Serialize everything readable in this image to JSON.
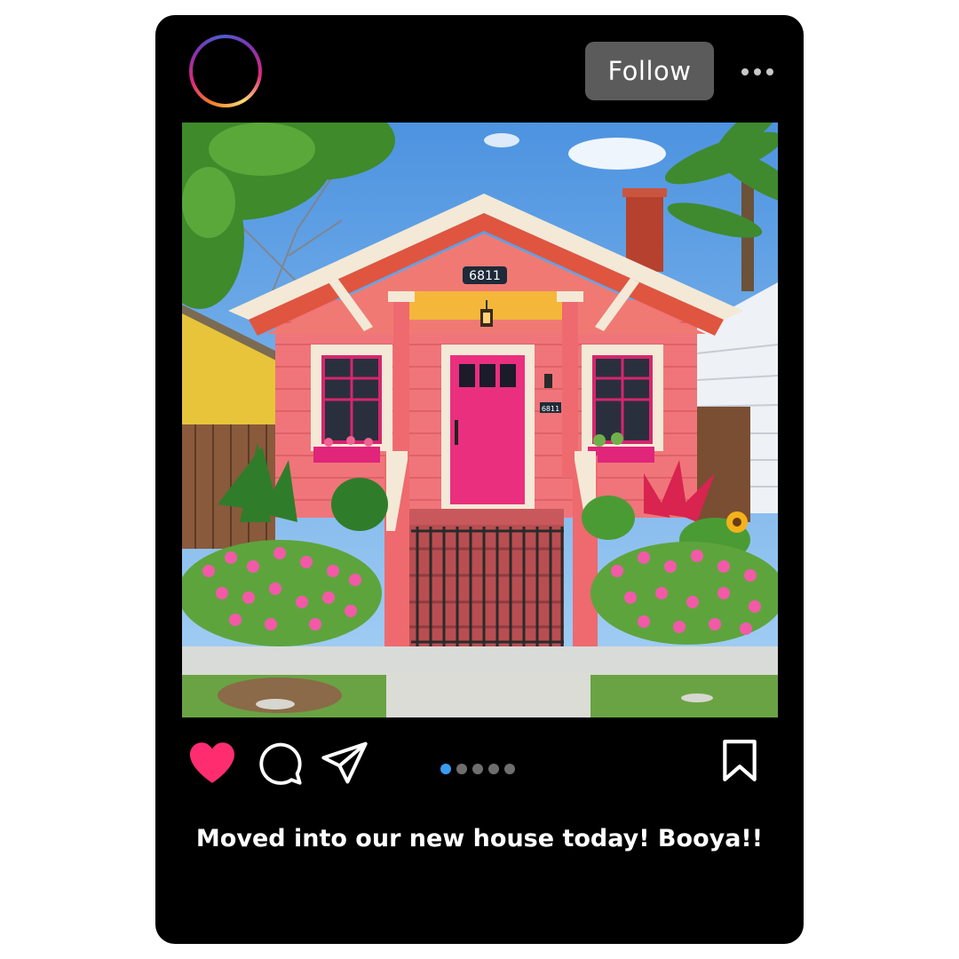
{
  "post": {
    "follow_label": "Follow",
    "caption": "Moved into our new house today! Booya!!",
    "house_number": "6811",
    "house_number_small": "6811",
    "carousel": {
      "count": 5,
      "active_index": 0
    },
    "liked": true
  },
  "icons": {
    "more": "more-horizontal-icon",
    "like": "heart-icon",
    "comment": "comment-icon",
    "share": "paper-plane-icon",
    "save": "bookmark-icon"
  },
  "colors": {
    "card_bg": "#000000",
    "like": "#ff2d6f",
    "follow_bg": "#5b5b5b",
    "carousel_active": "#3a9bf0",
    "carousel_inactive": "#6e6e6e"
  }
}
